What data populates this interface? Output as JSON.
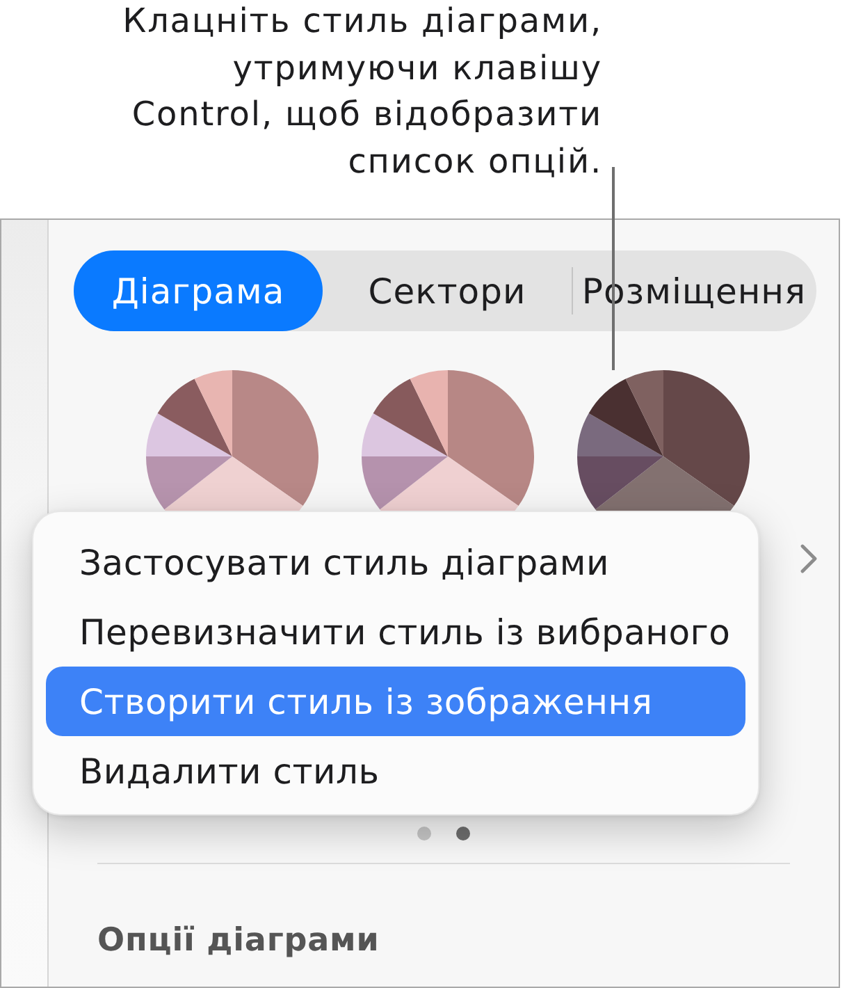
{
  "callout": {
    "text": "Клацніть стиль діаграми,\nутримуючи клавішу\nControl, щоб відобразити\nсписок опцій."
  },
  "tabs": [
    {
      "label": "Діаграма",
      "selected": true
    },
    {
      "label": "Сектори",
      "selected": false
    },
    {
      "label": "Розміщення",
      "selected": false
    }
  ],
  "chart_styles": [
    {
      "slices": [
        {
          "color": "#b88887"
        },
        {
          "color": "#efd1d1"
        },
        {
          "color": "#b794ae"
        },
        {
          "color": "#dcc6e1"
        },
        {
          "color": "#8a5c5f"
        },
        {
          "color": "#e8b5b1"
        }
      ]
    },
    {
      "slices": [
        {
          "color": "#b78785"
        },
        {
          "color": "#efd0d1"
        },
        {
          "color": "#b592ad"
        },
        {
          "color": "#dcc6e0"
        },
        {
          "color": "#875a5c"
        },
        {
          "color": "#e8b3af"
        }
      ]
    },
    {
      "slices": [
        {
          "color": "#654849"
        },
        {
          "color": "#837170"
        },
        {
          "color": "#674d61"
        },
        {
          "color": "#7a6a7e"
        },
        {
          "color": "#4a3031"
        },
        {
          "color": "#7f6160"
        }
      ]
    }
  ],
  "context_menu": {
    "items": [
      {
        "label": "Застосувати стиль діаграми",
        "selected": false
      },
      {
        "label": "Перевизначити стиль із вибраного",
        "selected": false
      },
      {
        "label": "Створити стиль із зображення",
        "selected": true
      },
      {
        "label": "Видалити стиль",
        "selected": false
      }
    ]
  },
  "page_dots": [
    {
      "selected": false
    },
    {
      "selected": true
    }
  ],
  "section_heading": "Опції діаграми"
}
